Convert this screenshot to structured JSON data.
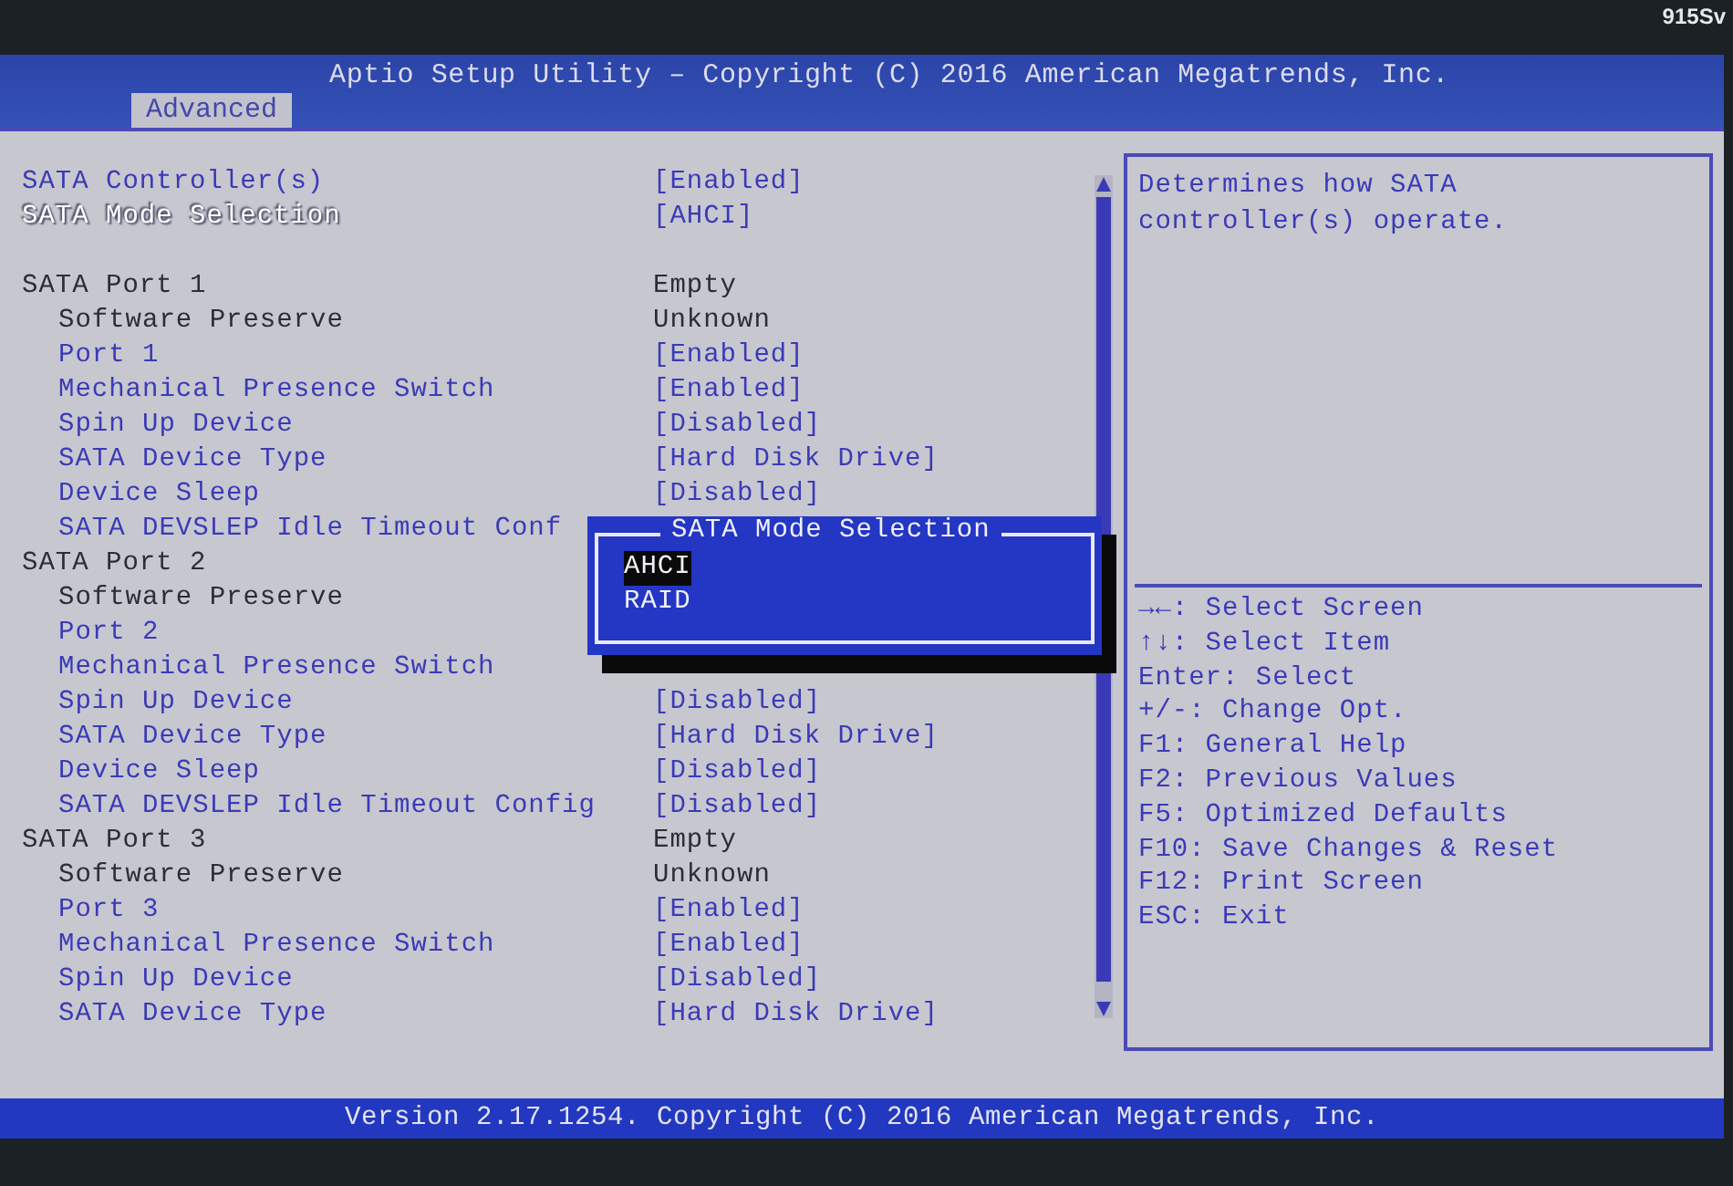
{
  "bezel": {
    "label": "915Sv"
  },
  "header": {
    "title": "Aptio Setup Utility – Copyright (C) 2016 American Megatrends, Inc.",
    "tabs": [
      {
        "label": "Advanced",
        "selected": true
      }
    ]
  },
  "settings": [
    {
      "kind": "setting",
      "label": "SATA Controller(s)",
      "value": "[Enabled]",
      "selected": false
    },
    {
      "kind": "setting",
      "label": "SATA Mode Selection",
      "value": "[AHCI]",
      "selected": true
    },
    {
      "kind": "group",
      "label": "SATA Port 1",
      "value": "Empty",
      "children": [
        {
          "kind": "info",
          "label": "Software Preserve",
          "value": "Unknown"
        },
        {
          "kind": "setting",
          "label": "Port 1",
          "value": "[Enabled]",
          "selected": false
        },
        {
          "kind": "setting",
          "label": "Mechanical Presence Switch",
          "value": "[Enabled]",
          "selected": false
        },
        {
          "kind": "setting",
          "label": "Spin Up Device",
          "value": "[Disabled]",
          "selected": false
        },
        {
          "kind": "setting",
          "label": "SATA Device Type",
          "value": "[Hard Disk Drive]",
          "selected": false
        },
        {
          "kind": "setting",
          "label": "Device Sleep",
          "value": "[Disabled]",
          "selected": false
        },
        {
          "kind": "setting",
          "label": "SATA DEVSLEP Idle Timeout Conf",
          "selected": false
        }
      ]
    },
    {
      "kind": "group",
      "label": "SATA Port 2",
      "children": [
        {
          "kind": "info",
          "label": "Software Preserve"
        },
        {
          "kind": "setting",
          "label": "Port 2",
          "selected": false
        },
        {
          "kind": "setting",
          "label": "Mechanical Presence Switch",
          "selected": false
        },
        {
          "kind": "setting",
          "label": "Spin Up Device",
          "value": "[Disabled]",
          "selected": false
        },
        {
          "kind": "setting",
          "label": "SATA Device Type",
          "value": "[Hard Disk Drive]",
          "selected": false
        },
        {
          "kind": "setting",
          "label": "Device Sleep",
          "value": "[Disabled]",
          "selected": false
        },
        {
          "kind": "setting",
          "label": "SATA DEVSLEP Idle Timeout Config",
          "value": "[Disabled]",
          "selected": false
        }
      ]
    },
    {
      "kind": "group",
      "label": "SATA Port 3",
      "value": "Empty",
      "children": [
        {
          "kind": "info",
          "label": "Software Preserve",
          "value": "Unknown"
        },
        {
          "kind": "setting",
          "label": "Port 3",
          "value": "[Enabled]",
          "selected": false
        },
        {
          "kind": "setting",
          "label": "Mechanical Presence Switch",
          "value": "[Enabled]",
          "selected": false
        },
        {
          "kind": "setting",
          "label": "Spin Up Device",
          "value": "[Disabled]",
          "selected": false
        },
        {
          "kind": "setting",
          "label": "SATA Device Type",
          "value": "[Hard Disk Drive]",
          "selected": false
        }
      ]
    }
  ],
  "popup": {
    "title": "SATA Mode Selection",
    "options": [
      {
        "label": "AHCI",
        "selected": true
      },
      {
        "label": "RAID",
        "selected": false
      }
    ]
  },
  "help_text": "Determines how SATA controller(s) operate.",
  "key_help": [
    "→←: Select Screen",
    "↑↓: Select Item",
    "Enter: Select",
    "+/-: Change Opt.",
    "F1: General Help",
    "F2: Previous Values",
    "F5: Optimized Defaults",
    "F10: Save Changes & Reset",
    "F12: Print Screen",
    "ESC: Exit"
  ],
  "footer": "Version 2.17.1254. Copyright (C) 2016 American Megatrends, Inc."
}
